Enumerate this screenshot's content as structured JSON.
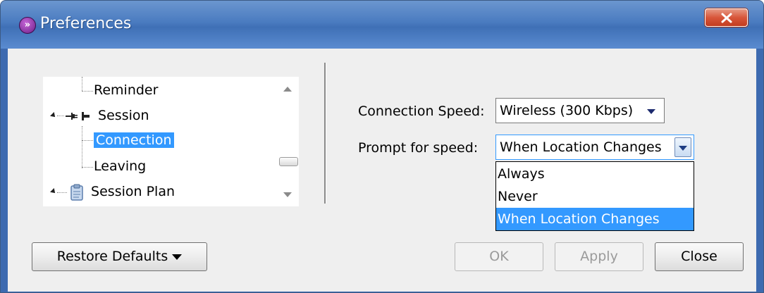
{
  "window": {
    "title": "Preferences",
    "close_symbol": "X"
  },
  "tree": {
    "items": [
      {
        "label": "Reminder",
        "icon": "none",
        "selected": false
      },
      {
        "label": "Session",
        "icon": "plug-icon",
        "selected": false,
        "expanded": true
      },
      {
        "label": "Connection",
        "icon": "none",
        "selected": true
      },
      {
        "label": "Leaving",
        "icon": "none",
        "selected": false
      },
      {
        "label": "Session Plan",
        "icon": "clipboard-icon",
        "selected": false,
        "expanded": true
      }
    ]
  },
  "form": {
    "connection_speed_label": "Connection Speed:",
    "connection_speed_value": "Wireless (300 Kbps)",
    "prompt_label": "Prompt for speed:",
    "prompt_value": "When Location Changes",
    "prompt_options": [
      "Always",
      "Never",
      "When Location Changes"
    ],
    "prompt_selected_index": 2
  },
  "buttons": {
    "restore_defaults": "Restore Defaults",
    "ok": "OK",
    "apply": "Apply",
    "close": "Close"
  },
  "colors": {
    "selection": "#3399ff",
    "title_bar": "#4a7bc0",
    "close_button": "#d8563a"
  }
}
